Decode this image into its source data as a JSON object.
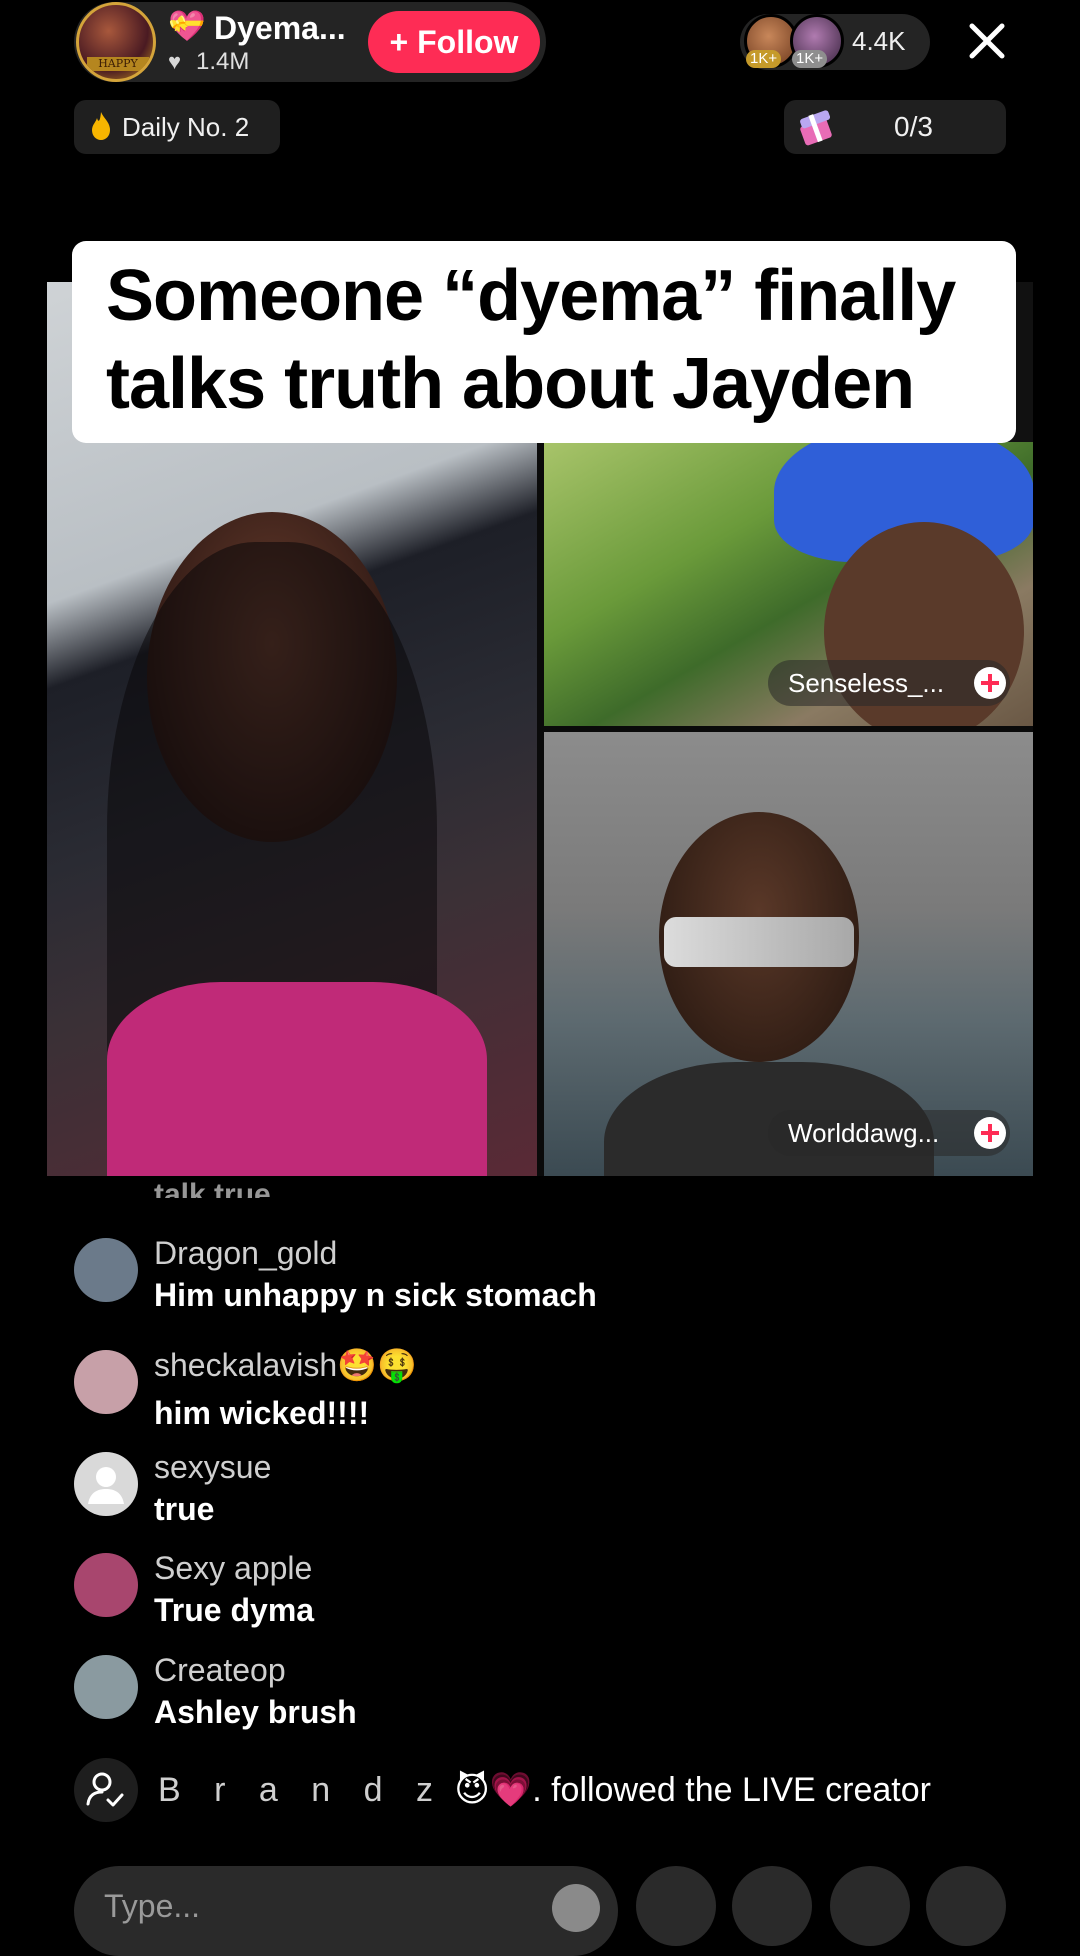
{
  "host": {
    "name": "Dyema...",
    "name_icon": "💝",
    "likes": "1.4M",
    "avatar_badge": "HAPPY",
    "follow_label": "+ Follow"
  },
  "viewers": {
    "badges": [
      "1K+",
      "1K+"
    ],
    "count": "4.4K"
  },
  "daily": {
    "label": "Daily No. 2",
    "icon": "flame-icon"
  },
  "goal": {
    "progress": "0/3",
    "icon": "gift-box-icon",
    "current": 0,
    "total": 3
  },
  "caption": {
    "line1": "Someone “dyema” finally",
    "line2": "talks truth about  Jayden"
  },
  "guests": [
    {
      "name": "Senseless_..."
    },
    {
      "name": "Worlddawg..."
    }
  ],
  "comments": {
    "faded_previous": "talk true",
    "items": [
      {
        "user": "Dragon_gold",
        "text": "Him unhappy n sick stomach",
        "avatar_color": "#6b7a8a"
      },
      {
        "user": "sheckalavish",
        "text": "him wicked!!!!",
        "avatar_color": "#c7a0a8",
        "emojis": [
          "🤩",
          "🤑"
        ]
      },
      {
        "user": "sexysue",
        "text": "true",
        "avatar_color": "#cfcfcf"
      },
      {
        "user": "Sexy apple",
        "text": "True dyma",
        "avatar_color": "#a8466e"
      },
      {
        "user": "Createop",
        "text": "Ashley brush",
        "avatar_color": "#8a9aa0"
      }
    ]
  },
  "join_event": {
    "user": "B r a n d z",
    "emojis": "😈💗",
    "text": ". followed the LIVE creator"
  },
  "composer": {
    "placeholder": "Type..."
  },
  "colors": {
    "accent": "#fe2c55",
    "background": "#000000",
    "pill": "#1f1f1f"
  }
}
